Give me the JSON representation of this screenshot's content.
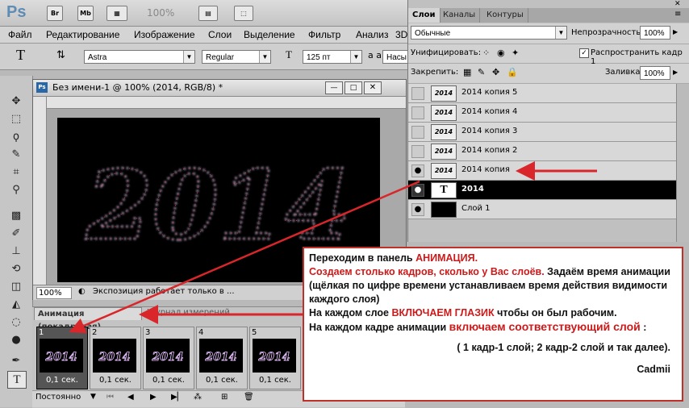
{
  "app": {
    "logo": "Ps",
    "br": "Br",
    "mb": "Mb",
    "zoom": "100%"
  },
  "menu": [
    "Файл",
    "Редактирование",
    "Изображение",
    "Слои",
    "Выделение",
    "Фильтр",
    "Анализ",
    "3D"
  ],
  "options": {
    "font_family": "Astra",
    "font_style": "Regular",
    "font_size": "125 пт",
    "aa_label": "a a",
    "aa_value": "Насы"
  },
  "document": {
    "title": "Без имени-1 @ 100% (2014, RGB/8) *",
    "zoom": "100%",
    "status": "Экспозиция работает только в ...",
    "canvas_text": "2014"
  },
  "animation": {
    "tab_label": "Анимация (покадровая)",
    "tab2": "Журнал измерений",
    "loop": "Постоянно",
    "frames": [
      {
        "num": "1",
        "time": "0,1 сек."
      },
      {
        "num": "2",
        "time": "0,1 сек."
      },
      {
        "num": "3",
        "time": "0,1 сек."
      },
      {
        "num": "4",
        "time": "0,1 сек."
      },
      {
        "num": "5",
        "time": "0,1 сек."
      }
    ]
  },
  "panel": {
    "tabs": [
      "Слои",
      "Каналы",
      "Контуры"
    ],
    "blend": "Обычные",
    "opacity_label": "Непрозрачность:",
    "opacity": "100%",
    "unify_label": "Унифицировать:",
    "propagate": "Распространить кадр 1",
    "lock_label": "Закрепить:",
    "fill_label": "Заливка:",
    "fill": "100%"
  },
  "layers": [
    {
      "name": "2014 копия 5",
      "visible": false
    },
    {
      "name": "2014 копия 4",
      "visible": false
    },
    {
      "name": "2014 копия 3",
      "visible": false
    },
    {
      "name": "2014 копия 2",
      "visible": false
    },
    {
      "name": "2014 копия",
      "visible": true
    },
    {
      "name": "2014",
      "visible": true,
      "type": "text"
    },
    {
      "name": "Слой 1",
      "visible": true,
      "type": "fill"
    }
  ],
  "note": {
    "l1a": "Переходим в панель ",
    "l1b": "АНИМАЦИЯ.",
    "l2a": "Создаем столько кадров, сколько у Вас слоёв.",
    "l2b": " Задаём время анимации  (щёлкая по цифре времени устанавливаем время действия видимости каждого слоя)",
    "l3a": "На каждом слое  ",
    "l3b": "ВКЛЮЧАЕМ ГЛАЗИК",
    "l3c": "  чтобы он был рабочим.",
    "l4a": "На каждом кадре анимации ",
    "l4b": "включаем соответствующий слой",
    "l4c": " :",
    "l5": "( 1 кадр-1 слой; 2 кадр-2 слой и так далее).",
    "sign": "Cadmii"
  }
}
